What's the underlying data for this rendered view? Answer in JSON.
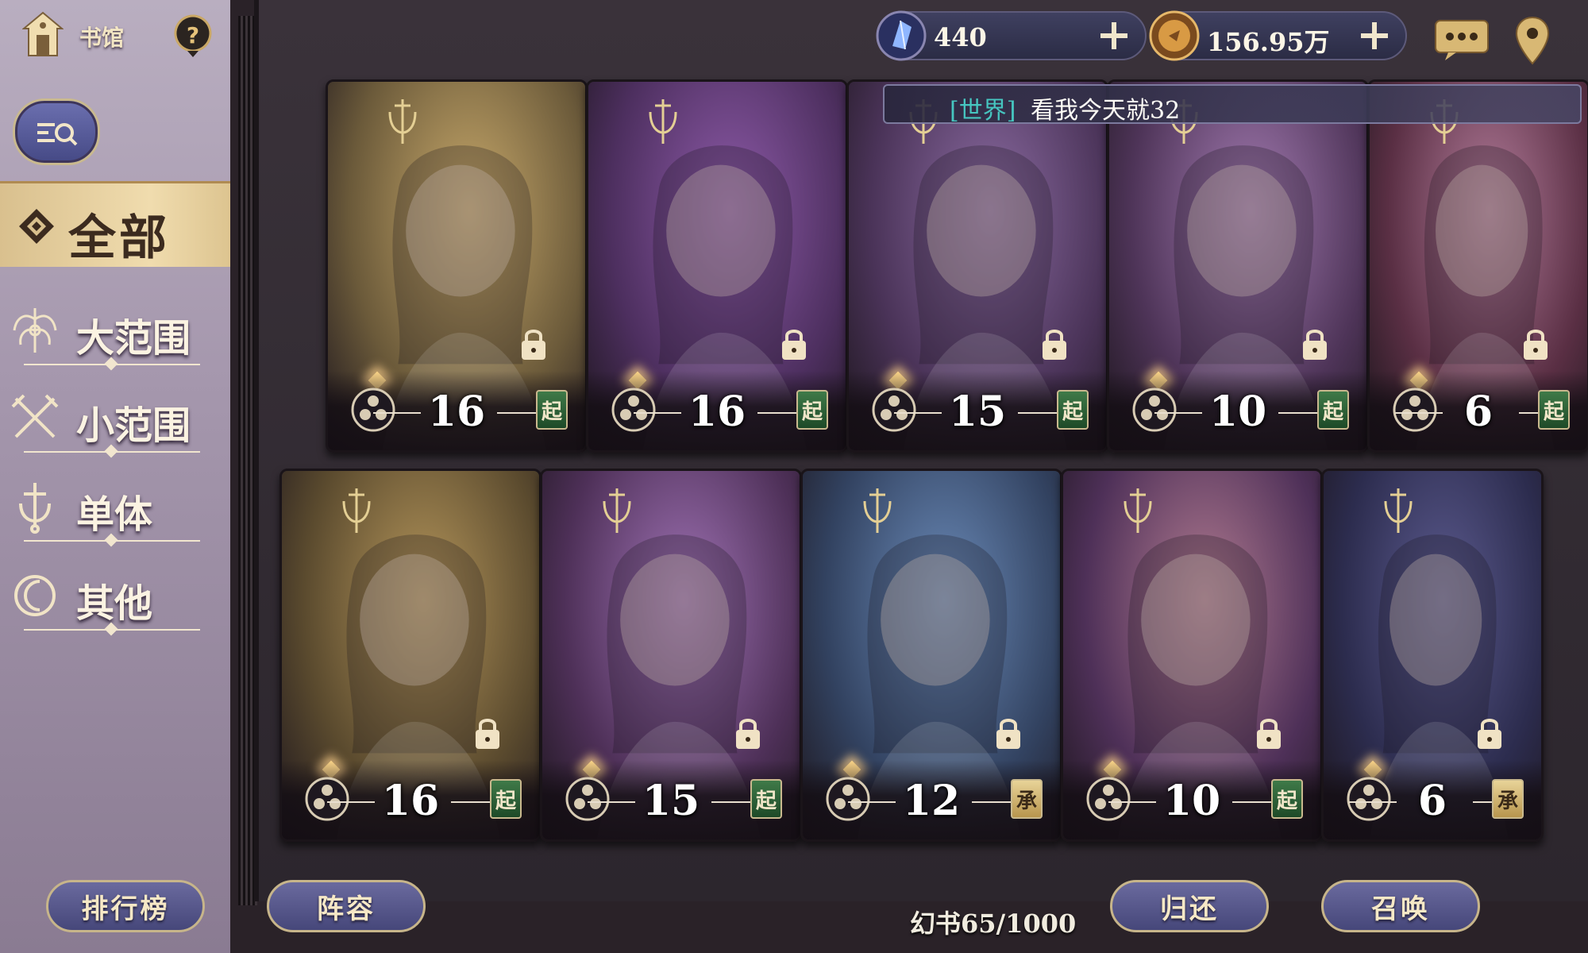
{
  "sidebar": {
    "library_label": "书馆",
    "all_label": "全部",
    "categories": [
      {
        "label": "大范围",
        "icon": "wide-range-icon"
      },
      {
        "label": "小范围",
        "icon": "crossed-swords-icon"
      },
      {
        "label": "单体",
        "icon": "sword-icon"
      },
      {
        "label": "其他",
        "icon": "moon-icon"
      }
    ]
  },
  "resources": {
    "crystal": {
      "value": "440",
      "icon": "crystal-icon"
    },
    "gold": {
      "value": "156.95万",
      "icon": "coin-icon"
    }
  },
  "world_chat": {
    "channel": "[世界]",
    "message": "看我今天就32"
  },
  "cards": [
    {
      "level": "16",
      "tag": "起",
      "tag_type": "qi",
      "palette": [
        "#6b5a3a",
        "#c7a86a"
      ]
    },
    {
      "level": "16",
      "tag": "起",
      "tag_type": "qi",
      "palette": [
        "#4d2f5f",
        "#8d5aa8"
      ]
    },
    {
      "level": "15",
      "tag": "起",
      "tag_type": "qi",
      "palette": [
        "#4a3358",
        "#8a6aa0"
      ]
    },
    {
      "level": "10",
      "tag": "起",
      "tag_type": "qi",
      "palette": [
        "#4e3458",
        "#a27ab0"
      ]
    },
    {
      "level": "6",
      "tag": "起",
      "tag_type": "qi",
      "palette": [
        "#5a2f44",
        "#b07a98"
      ]
    },
    {
      "level": "16",
      "tag": "起",
      "tag_type": "qi",
      "palette": [
        "#5a4a2e",
        "#b4955a"
      ]
    },
    {
      "level": "15",
      "tag": "起",
      "tag_type": "qi",
      "palette": [
        "#4e3058",
        "#9f72b4"
      ]
    },
    {
      "level": "12",
      "tag": "承",
      "tag_type": "cheng",
      "palette": [
        "#324260",
        "#6a8ab8"
      ]
    },
    {
      "level": "10",
      "tag": "起",
      "tag_type": "qi",
      "palette": [
        "#4e3058",
        "#b07a90"
      ]
    },
    {
      "level": "6",
      "tag": "承",
      "tag_type": "cheng",
      "palette": [
        "#2c2c4e",
        "#5b5a8e"
      ]
    }
  ],
  "bottom": {
    "ranking": "排行榜",
    "lineup": "阵容",
    "return": "归还",
    "summon": "召唤",
    "book_count": "幻书65/1000"
  }
}
